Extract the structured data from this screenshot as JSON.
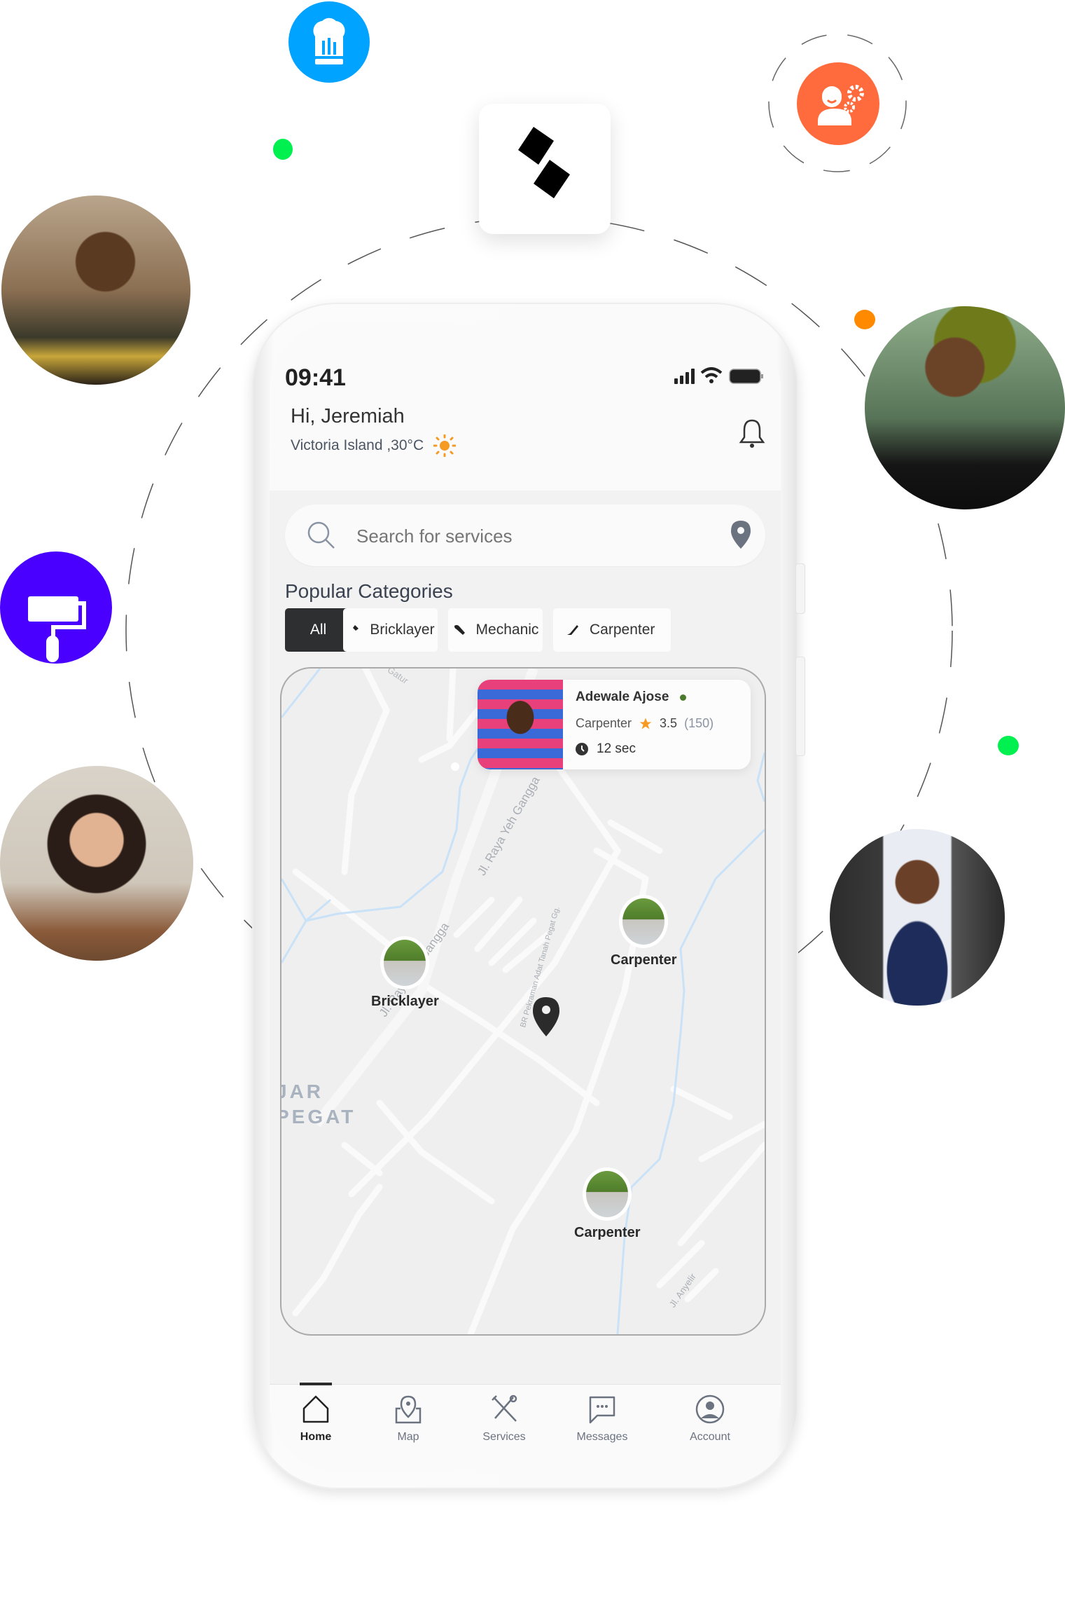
{
  "decor": {
    "logo_icon": "app-logo-icon",
    "badges": [
      {
        "icon": "chef-hat-icon",
        "color": "#00A3FF"
      },
      {
        "icon": "worker-gears-icon",
        "color": "#FF6B3D"
      },
      {
        "icon": "paint-roller-icon",
        "color": "#4A00FF"
      }
    ],
    "dots": {
      "green": "#00F050",
      "orange": "#FF8A00"
    }
  },
  "status_bar": {
    "time": "09:41"
  },
  "header": {
    "greeting": "Hi, Jeremiah",
    "location": "Victoria Island ,30°C",
    "weather_icon": "sun-icon",
    "notification_icon": "bell-icon"
  },
  "search": {
    "placeholder": "Search for services",
    "location_icon": "location-pin-icon"
  },
  "categories": {
    "title": "Popular Categories",
    "chips": [
      {
        "label": "All",
        "active": true
      },
      {
        "label": "Bricklayer",
        "icon": "hammer-icon"
      },
      {
        "label": "Mechanic",
        "icon": "wrench-icon"
      },
      {
        "label": "Carpenter",
        "icon": "saw-icon"
      }
    ]
  },
  "map": {
    "street_labels": [
      "Gatur",
      "Jl. Raya Yeh Gangga",
      "Jl. Raya Yeh Gangga",
      "BR Pekraman Adat Tanah Pegat Gg.",
      "Jl. Anyelir"
    ],
    "area_label_1": "JAR",
    "area_label_2": "PEGAT",
    "markers": [
      {
        "label": "Bricklayer"
      },
      {
        "label": "Carpenter"
      },
      {
        "label": "Carpenter"
      }
    ],
    "provider_card": {
      "name": "Adewale Ajose",
      "online_color": "#4B7A2A",
      "role": "Carpenter",
      "rating": "3.5",
      "reviews": "(150)",
      "eta": "12 sec"
    }
  },
  "tabbar": {
    "items": [
      {
        "label": "Home",
        "icon": "home-icon",
        "active": true
      },
      {
        "label": "Map",
        "icon": "map-pin-icon"
      },
      {
        "label": "Services",
        "icon": "tools-icon"
      },
      {
        "label": "Messages",
        "icon": "chat-icon"
      },
      {
        "label": "Account",
        "icon": "account-icon"
      }
    ]
  }
}
